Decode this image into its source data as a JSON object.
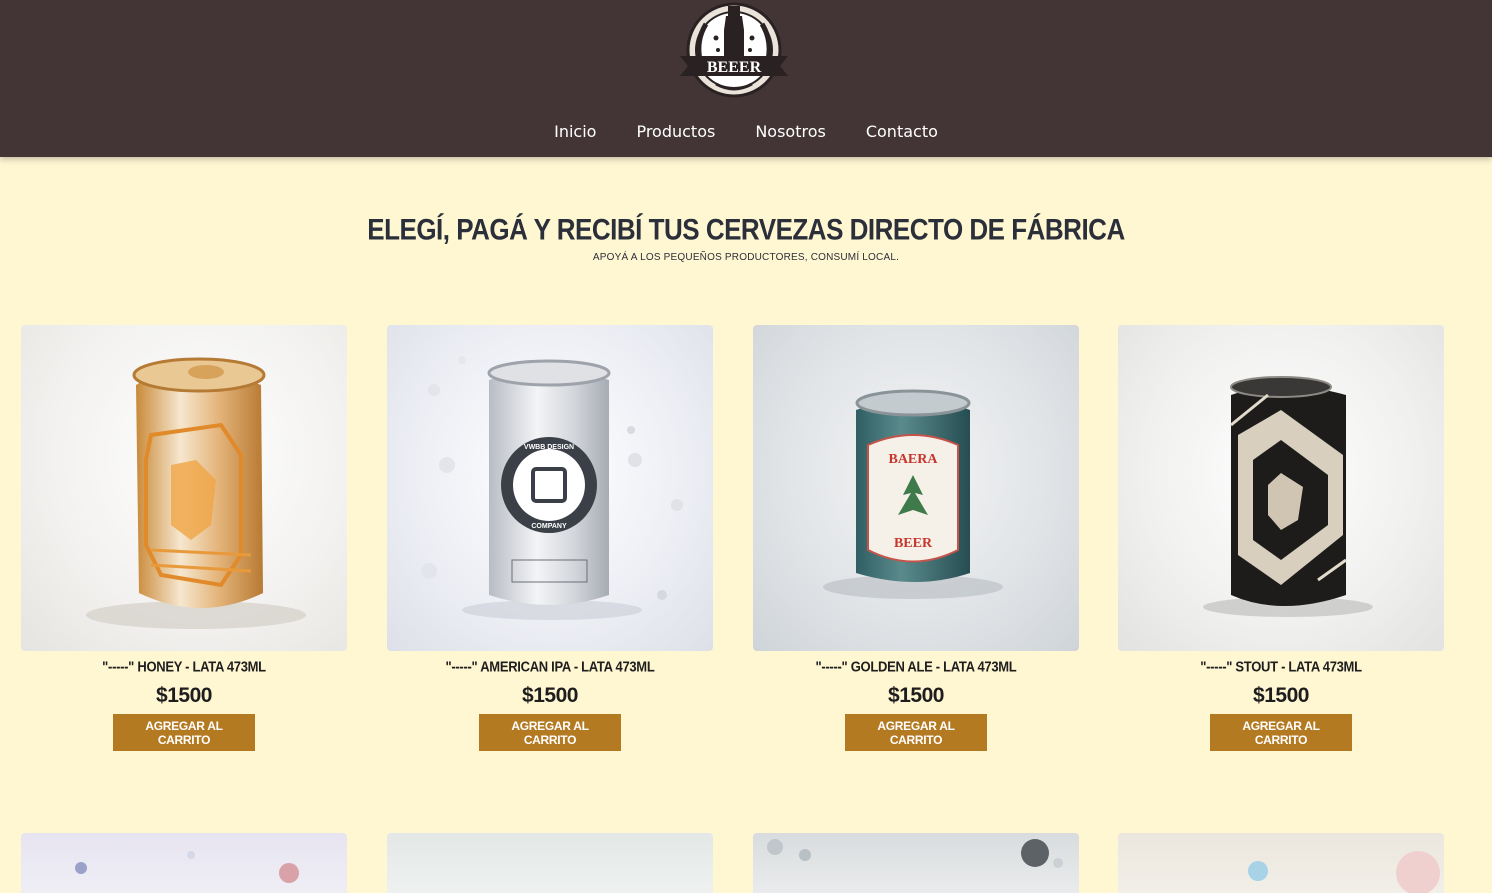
{
  "header": {
    "logo_text": "BEEER",
    "nav": [
      "Inicio",
      "Productos",
      "Nosotros",
      "Contacto"
    ]
  },
  "hero": {
    "title": "Elegí, pagá y recibí tus cervezas directo de fábrica",
    "subtitle": "Apoyá a los pequeños productores, consumí local."
  },
  "products": [
    {
      "name": "\"-----\" Honey - Lata 473ml",
      "price": "$1500",
      "button": "Agregar al carrito"
    },
    {
      "name": "\"-----\" American IPA - Lata 473ml",
      "price": "$1500",
      "button": "Agregar al carrito"
    },
    {
      "name": "\"-----\" Golden Ale - Lata 473ml",
      "price": "$1500",
      "button": "Agregar al carrito"
    },
    {
      "name": "\"-----\" Stout - Lata 473ml",
      "price": "$1500",
      "button": "Agregar al carrito"
    }
  ],
  "can_labels": {
    "can2_badge_top": "VWBB DESIGN",
    "can2_badge_bottom": "COMPANY",
    "can3_top": "BAERA",
    "can3_bottom": "BEER"
  }
}
